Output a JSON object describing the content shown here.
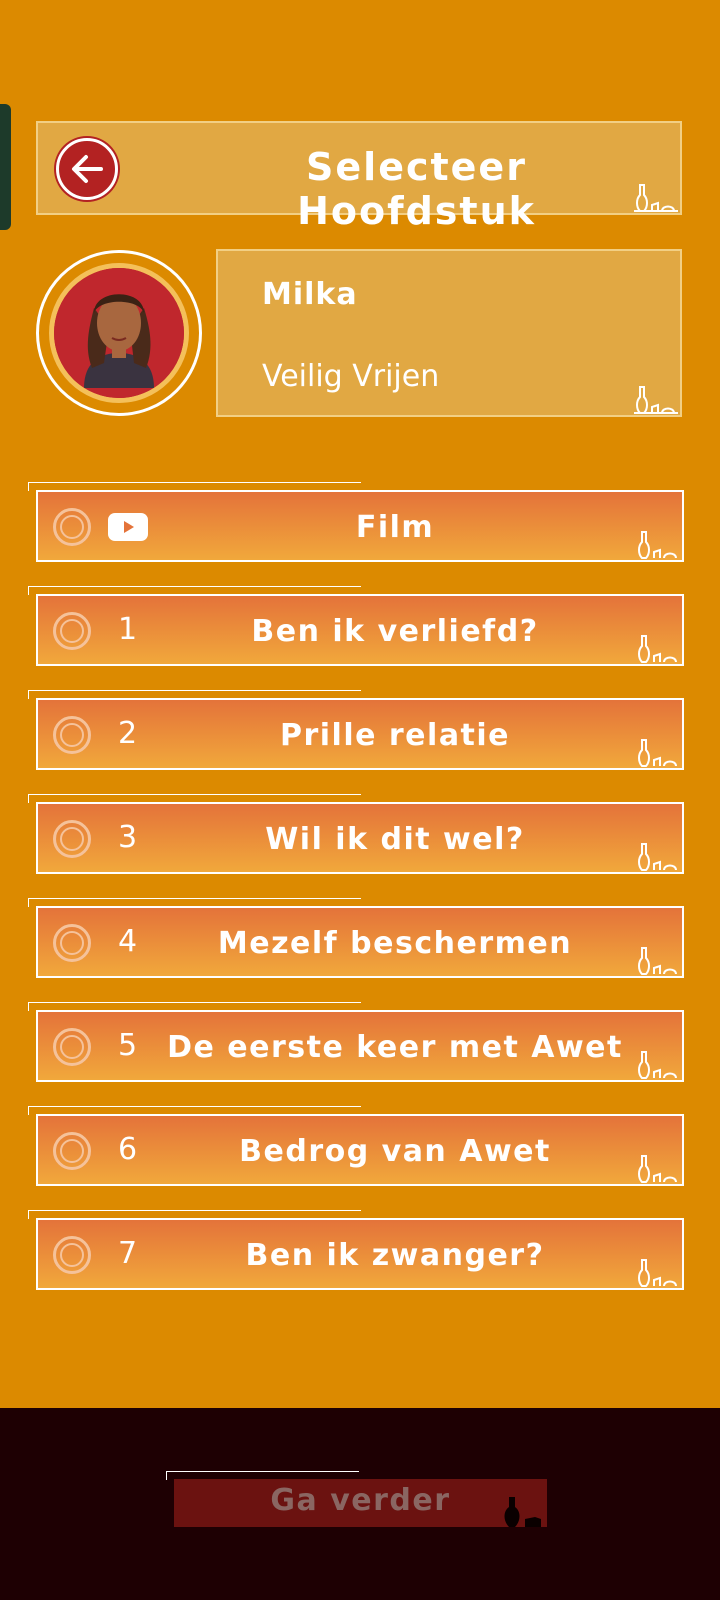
{
  "header": {
    "title": "Selecteer Hoofdstuk",
    "back_icon": "arrow-left-icon"
  },
  "character": {
    "name": "Milka",
    "topic": "Veilig Vrijen"
  },
  "chapters": [
    {
      "num": "",
      "label": "Film",
      "icon": "youtube-play-icon"
    },
    {
      "num": "1",
      "label": "Ben ik verliefd?"
    },
    {
      "num": "2",
      "label": "Prille relatie"
    },
    {
      "num": "3",
      "label": "Wil ik dit wel?"
    },
    {
      "num": "4",
      "label": "Mezelf beschermen"
    },
    {
      "num": "5",
      "label": "De eerste keer met Awet"
    },
    {
      "num": "6",
      "label": "Bedrog van Awet"
    },
    {
      "num": "7",
      "label": "Ben ik zwanger?"
    }
  ],
  "footer": {
    "continue_label": "Ga verder"
  },
  "colors": {
    "background": "#dc8a00",
    "chapter_gradient_top": "#e4733a",
    "chapter_gradient_bottom": "#f1a83b",
    "back_button": "#b32222",
    "footer_bg": "#1e0003",
    "continue_button": "#6b1210"
  }
}
